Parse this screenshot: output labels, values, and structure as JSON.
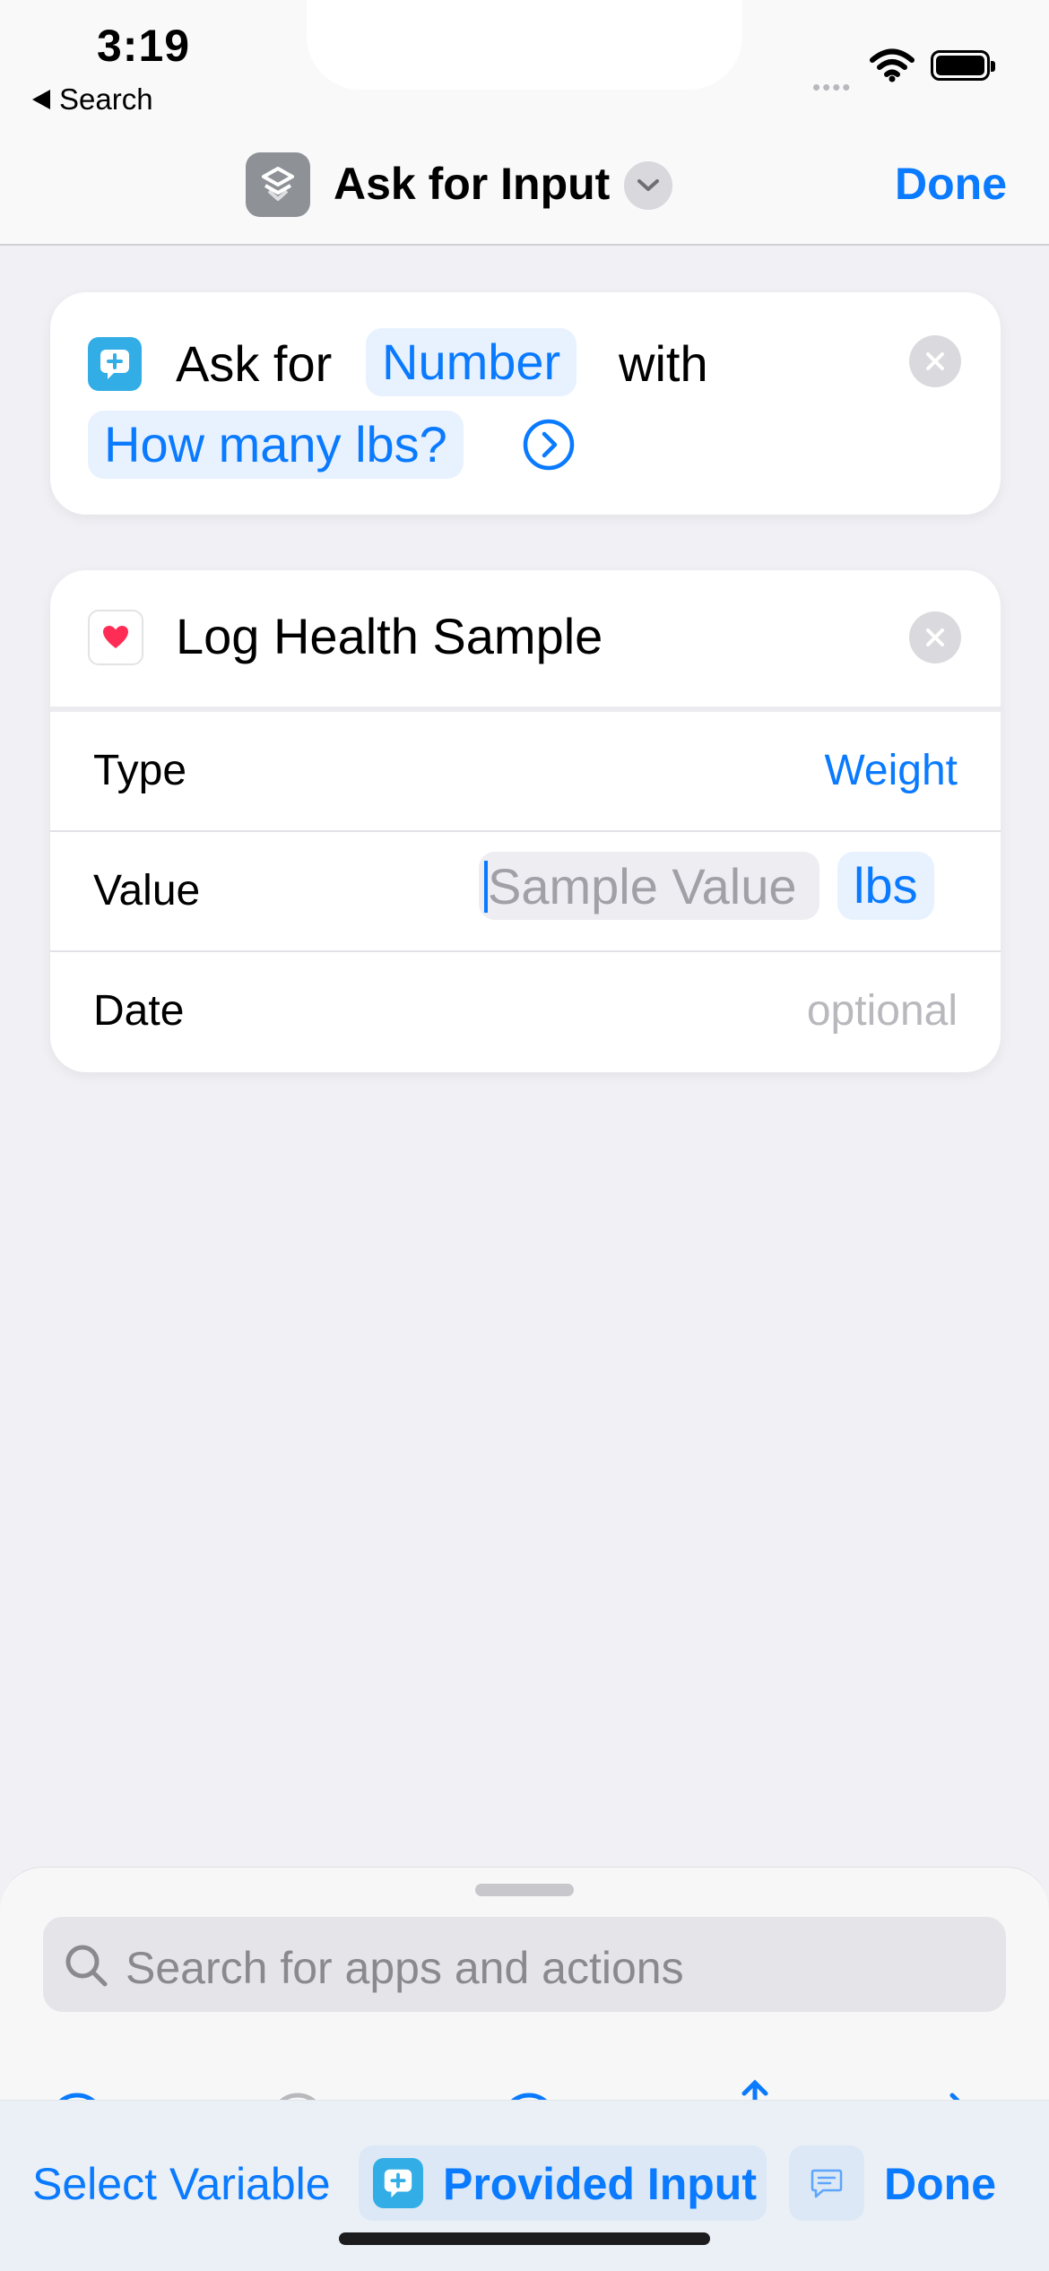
{
  "status_bar": {
    "time": "3:19",
    "back_label": "Search",
    "signal_dots": "••••"
  },
  "nav": {
    "title": "Ask for Input",
    "done": "Done",
    "app_icon": "shortcuts-icon"
  },
  "ask_card": {
    "word_ask_for": "Ask for",
    "chip_type": "Number",
    "word_with": "with",
    "chip_prompt": "How many lbs?",
    "icon": "ask-input-icon"
  },
  "health_card": {
    "title": "Log Health Sample",
    "icon": "heart-icon",
    "rows": [
      {
        "label": "Type",
        "value": "Weight"
      },
      {
        "label": "Value",
        "placeholder": "Sample Value",
        "unit": "lbs"
      },
      {
        "label": "Date",
        "placeholder": "optional"
      }
    ]
  },
  "sheet": {
    "search_placeholder": "Search for apps and actions"
  },
  "toolbar": {
    "select_variable": "Select Variable",
    "provided_input": "Provided Input",
    "done": "Done"
  },
  "colors": {
    "accent": "#0a7aff",
    "chip_bg": "#e8f2ff",
    "background": "#f0f0f5",
    "heart": "#ff2d55",
    "ask_icon": "#32ade6"
  }
}
